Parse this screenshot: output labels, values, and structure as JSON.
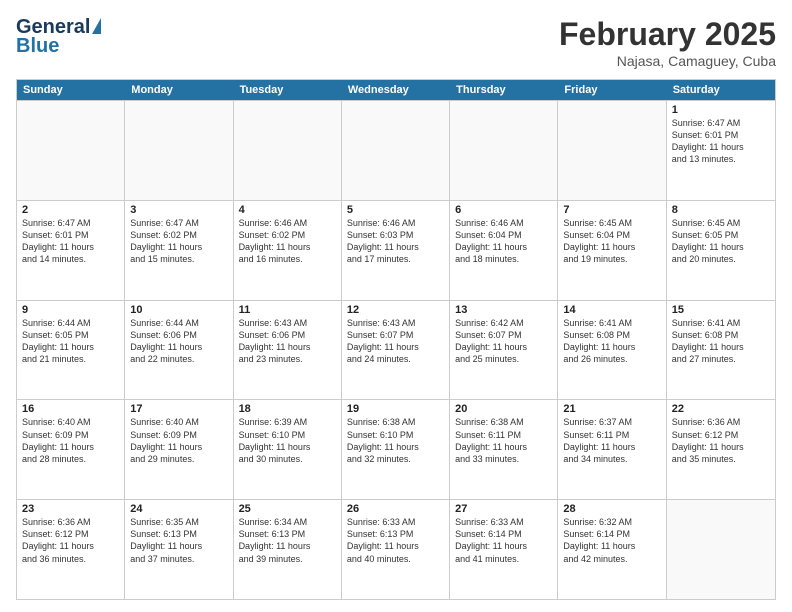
{
  "header": {
    "logo": {
      "line1": "General",
      "triangle": true,
      "line2": "Blue"
    },
    "title": "February 2025",
    "subtitle": "Najasa, Camaguey, Cuba"
  },
  "calendar": {
    "days_of_week": [
      "Sunday",
      "Monday",
      "Tuesday",
      "Wednesday",
      "Thursday",
      "Friday",
      "Saturday"
    ],
    "weeks": [
      [
        {
          "day": "",
          "text": ""
        },
        {
          "day": "",
          "text": ""
        },
        {
          "day": "",
          "text": ""
        },
        {
          "day": "",
          "text": ""
        },
        {
          "day": "",
          "text": ""
        },
        {
          "day": "",
          "text": ""
        },
        {
          "day": "1",
          "text": "Sunrise: 6:47 AM\nSunset: 6:01 PM\nDaylight: 11 hours\nand 13 minutes."
        }
      ],
      [
        {
          "day": "2",
          "text": "Sunrise: 6:47 AM\nSunset: 6:01 PM\nDaylight: 11 hours\nand 14 minutes."
        },
        {
          "day": "3",
          "text": "Sunrise: 6:47 AM\nSunset: 6:02 PM\nDaylight: 11 hours\nand 15 minutes."
        },
        {
          "day": "4",
          "text": "Sunrise: 6:46 AM\nSunset: 6:02 PM\nDaylight: 11 hours\nand 16 minutes."
        },
        {
          "day": "5",
          "text": "Sunrise: 6:46 AM\nSunset: 6:03 PM\nDaylight: 11 hours\nand 17 minutes."
        },
        {
          "day": "6",
          "text": "Sunrise: 6:46 AM\nSunset: 6:04 PM\nDaylight: 11 hours\nand 18 minutes."
        },
        {
          "day": "7",
          "text": "Sunrise: 6:45 AM\nSunset: 6:04 PM\nDaylight: 11 hours\nand 19 minutes."
        },
        {
          "day": "8",
          "text": "Sunrise: 6:45 AM\nSunset: 6:05 PM\nDaylight: 11 hours\nand 20 minutes."
        }
      ],
      [
        {
          "day": "9",
          "text": "Sunrise: 6:44 AM\nSunset: 6:05 PM\nDaylight: 11 hours\nand 21 minutes."
        },
        {
          "day": "10",
          "text": "Sunrise: 6:44 AM\nSunset: 6:06 PM\nDaylight: 11 hours\nand 22 minutes."
        },
        {
          "day": "11",
          "text": "Sunrise: 6:43 AM\nSunset: 6:06 PM\nDaylight: 11 hours\nand 23 minutes."
        },
        {
          "day": "12",
          "text": "Sunrise: 6:43 AM\nSunset: 6:07 PM\nDaylight: 11 hours\nand 24 minutes."
        },
        {
          "day": "13",
          "text": "Sunrise: 6:42 AM\nSunset: 6:07 PM\nDaylight: 11 hours\nand 25 minutes."
        },
        {
          "day": "14",
          "text": "Sunrise: 6:41 AM\nSunset: 6:08 PM\nDaylight: 11 hours\nand 26 minutes."
        },
        {
          "day": "15",
          "text": "Sunrise: 6:41 AM\nSunset: 6:08 PM\nDaylight: 11 hours\nand 27 minutes."
        }
      ],
      [
        {
          "day": "16",
          "text": "Sunrise: 6:40 AM\nSunset: 6:09 PM\nDaylight: 11 hours\nand 28 minutes."
        },
        {
          "day": "17",
          "text": "Sunrise: 6:40 AM\nSunset: 6:09 PM\nDaylight: 11 hours\nand 29 minutes."
        },
        {
          "day": "18",
          "text": "Sunrise: 6:39 AM\nSunset: 6:10 PM\nDaylight: 11 hours\nand 30 minutes."
        },
        {
          "day": "19",
          "text": "Sunrise: 6:38 AM\nSunset: 6:10 PM\nDaylight: 11 hours\nand 32 minutes."
        },
        {
          "day": "20",
          "text": "Sunrise: 6:38 AM\nSunset: 6:11 PM\nDaylight: 11 hours\nand 33 minutes."
        },
        {
          "day": "21",
          "text": "Sunrise: 6:37 AM\nSunset: 6:11 PM\nDaylight: 11 hours\nand 34 minutes."
        },
        {
          "day": "22",
          "text": "Sunrise: 6:36 AM\nSunset: 6:12 PM\nDaylight: 11 hours\nand 35 minutes."
        }
      ],
      [
        {
          "day": "23",
          "text": "Sunrise: 6:36 AM\nSunset: 6:12 PM\nDaylight: 11 hours\nand 36 minutes."
        },
        {
          "day": "24",
          "text": "Sunrise: 6:35 AM\nSunset: 6:13 PM\nDaylight: 11 hours\nand 37 minutes."
        },
        {
          "day": "25",
          "text": "Sunrise: 6:34 AM\nSunset: 6:13 PM\nDaylight: 11 hours\nand 39 minutes."
        },
        {
          "day": "26",
          "text": "Sunrise: 6:33 AM\nSunset: 6:13 PM\nDaylight: 11 hours\nand 40 minutes."
        },
        {
          "day": "27",
          "text": "Sunrise: 6:33 AM\nSunset: 6:14 PM\nDaylight: 11 hours\nand 41 minutes."
        },
        {
          "day": "28",
          "text": "Sunrise: 6:32 AM\nSunset: 6:14 PM\nDaylight: 11 hours\nand 42 minutes."
        },
        {
          "day": "",
          "text": ""
        }
      ]
    ]
  }
}
